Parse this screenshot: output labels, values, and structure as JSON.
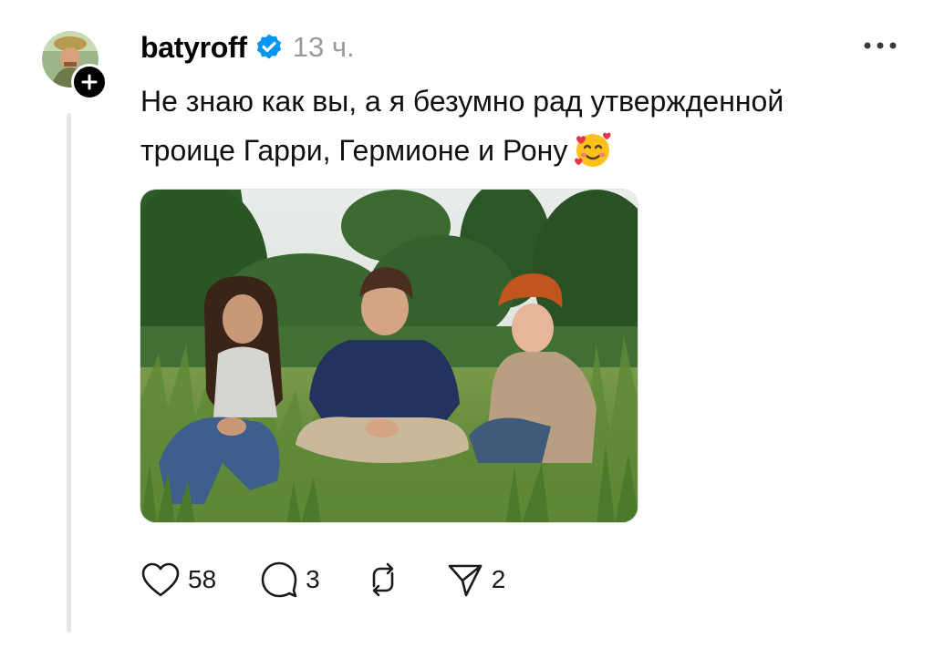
{
  "post": {
    "username": "batyroff",
    "timestamp": "13 ч.",
    "text_line1": "Не знаю как вы, а я безумно рад утвержденной",
    "text_line2": "троице Гарри, Гермионе и Рону"
  },
  "actions": {
    "likes": "58",
    "comments": "3",
    "shares": "2"
  },
  "icons": {
    "verified": "verified-check-icon",
    "more": "more-dots-icon",
    "like": "heart-icon",
    "comment": "comment-bubble-icon",
    "repost": "repost-icon",
    "share": "send-icon",
    "follow": "plus-icon",
    "emoji": "smiling-face-with-hearts"
  },
  "colors": {
    "verified_blue": "#0095f6",
    "timestamp_gray": "#9a9a9a",
    "thread_line": "#e6e6e6"
  }
}
